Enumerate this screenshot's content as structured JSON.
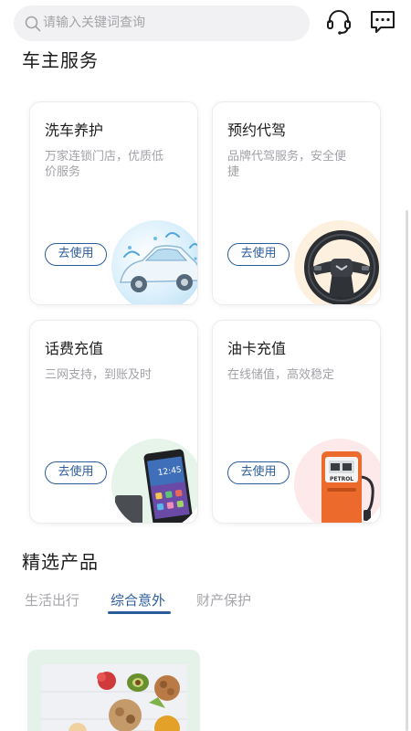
{
  "search": {
    "placeholder": "请输入关键词查询"
  },
  "service_section": {
    "title": "车主服务"
  },
  "services": [
    {
      "title": "洗车养护",
      "desc": "万家连锁门店，优质低价服务",
      "button": "去使用"
    },
    {
      "title": "预约代驾",
      "desc": "品牌代驾服务，安全便捷",
      "button": "去使用"
    },
    {
      "title": "话费充值",
      "desc": "三网支持，到账及时",
      "button": "去使用"
    },
    {
      "title": "油卡充值",
      "desc": "在线储值，高效稳定",
      "button": "去使用"
    }
  ],
  "products_section": {
    "title": "精选产品"
  },
  "product_tabs": [
    {
      "label": "生活出行"
    },
    {
      "label": "综合意外"
    },
    {
      "label": "财产保护"
    }
  ],
  "active_tab_index": 1,
  "fuel_pump_label": "PETROL",
  "phone_time": "12:45",
  "colors": {
    "accent": "#2b5c9c",
    "muted": "#a2a2a8"
  }
}
